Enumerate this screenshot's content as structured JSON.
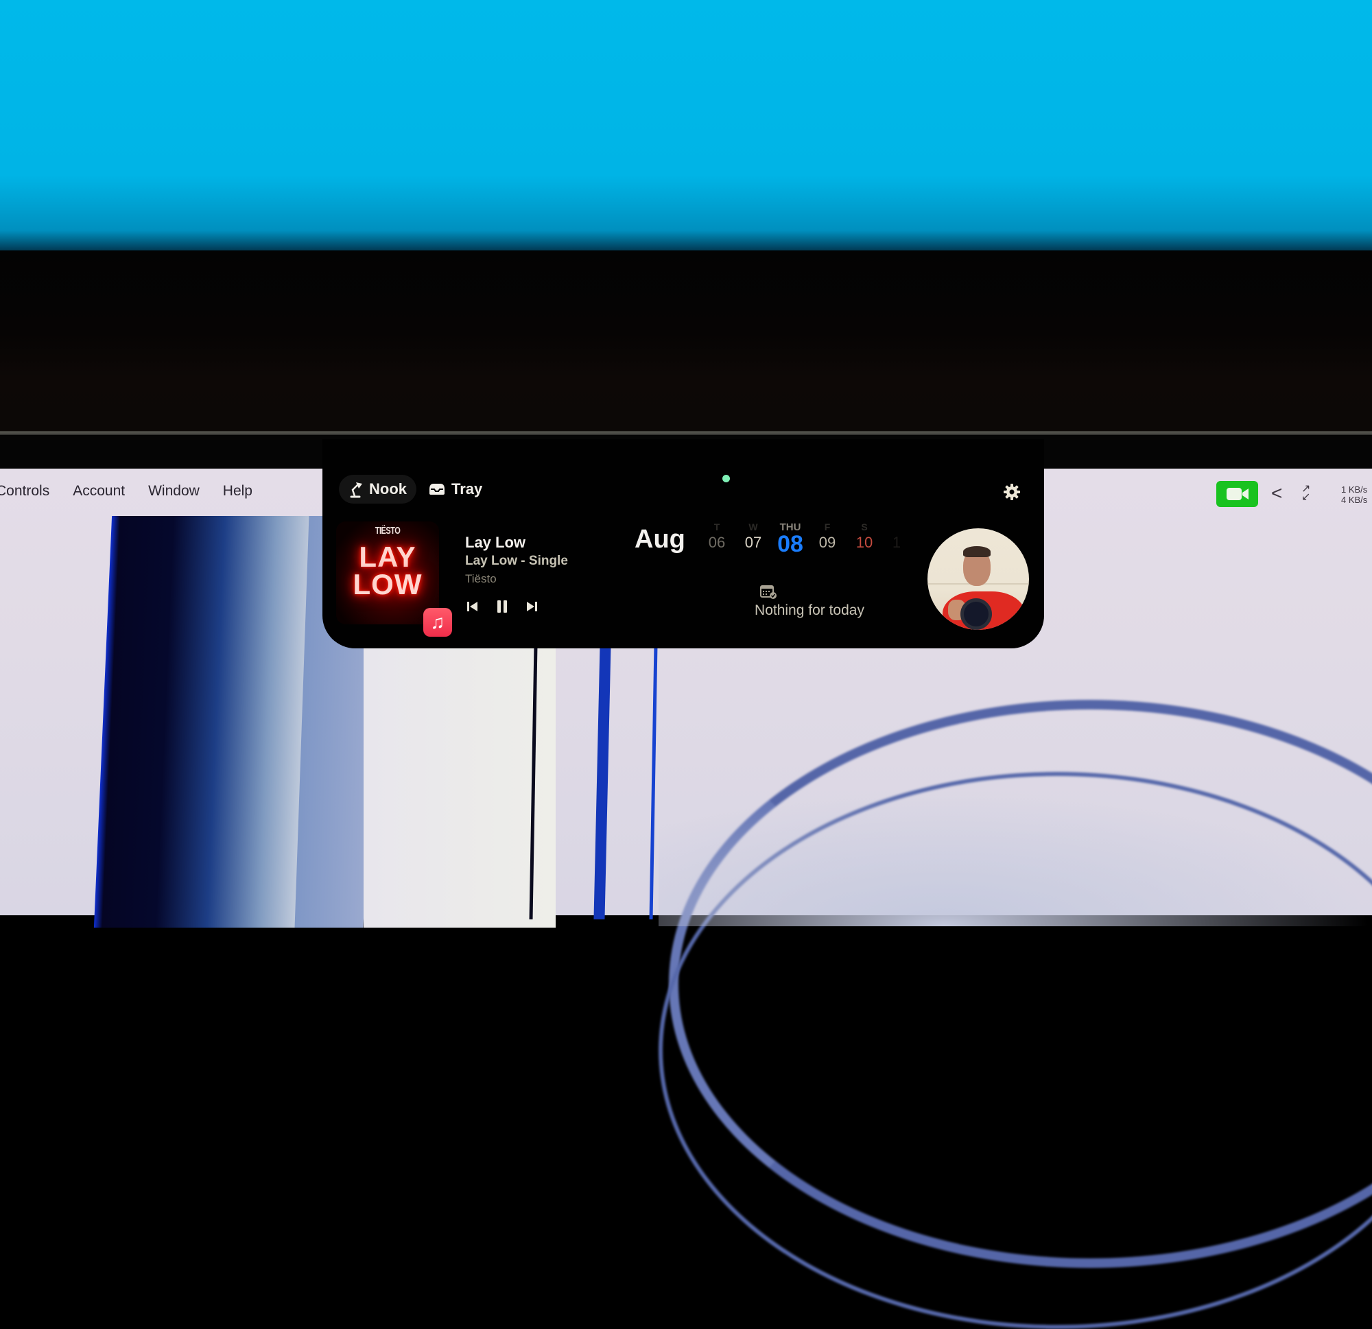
{
  "menubar_left": {
    "items": [
      "Controls",
      "Account",
      "Window",
      "Help"
    ]
  },
  "menubar_right": {
    "facetime_icon": "video-camera-icon",
    "facetime_color": "#19c21f",
    "chevron_icon": "chevron-left-icon",
    "chevron": "<",
    "arrows_icon": "expand-arrows-icon",
    "network_upload": "1 KB/s",
    "network_download": "4 KB/s"
  },
  "notch": {
    "tabs": [
      {
        "label": "Nook",
        "icon": "desk-lamp-icon",
        "active": true
      },
      {
        "label": "Tray",
        "icon": "tray-icon",
        "active": false
      }
    ],
    "status_dot_color": "#7ff0b6",
    "settings_icon": "gear-icon",
    "now_playing": {
      "album_art_artist": "TIËSTO",
      "album_art_title_line1": "LAY",
      "album_art_title_line2": "LOW",
      "source_app_icon": "apple-music-icon",
      "title": "Lay Low",
      "album": "Lay Low - Single",
      "artist": "Tiësto",
      "controls": [
        "previous",
        "pause",
        "next"
      ],
      "state": "playing"
    },
    "calendar": {
      "month": "Aug",
      "days": [
        {
          "label": "T",
          "number": "06",
          "state": "past"
        },
        {
          "label": "W",
          "number": "07",
          "state": "normal"
        },
        {
          "label": "THU",
          "number": "08",
          "state": "today"
        },
        {
          "label": "F",
          "number": "09",
          "state": "normal"
        },
        {
          "label": "S",
          "number": "10",
          "state": "weekend"
        },
        {
          "label": "",
          "number": "1",
          "state": "faded"
        }
      ],
      "accent_color": "#1a7dff",
      "weekend_color": "#c44b3f",
      "empty_icon": "calendar-check-icon",
      "empty_message": "Nothing for today"
    },
    "mirror_label": "camera-mirror"
  }
}
